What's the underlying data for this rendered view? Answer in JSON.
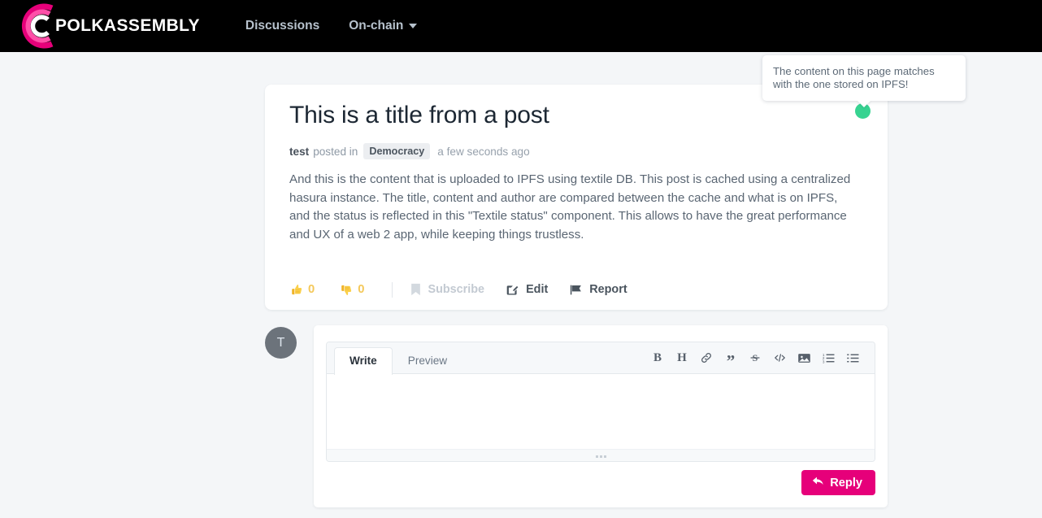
{
  "navbar": {
    "brand": "POLKASSEMBLY",
    "logo_icon": "polkassembly-spiral-logo",
    "links": [
      {
        "label": "Discussions",
        "icon": "",
        "has_caret": false
      },
      {
        "label": "On-chain",
        "icon": "chevron-down-icon",
        "has_caret": true
      }
    ]
  },
  "tooltip": {
    "text": "The content on this page matches with the one stored on IPFS!"
  },
  "post": {
    "title": "This is a title from a post",
    "author": "test",
    "posted_in_label": "posted in",
    "category": "Democracy",
    "time": "a few seconds ago",
    "content": "And this is the content that is uploaded to IPFS using textile DB. This post is cached using a centralized hasura instance. The title, content and author are compared between the cache and what is on IPFS, and the status is reflected in this \"Textile status\" component. This allows to have the great performance and UX of a web 2 app, while keeping things trustless.",
    "status_dot_color": "#37d391",
    "actions": {
      "like_count": "0",
      "dislike_count": "0",
      "like_icon": "thumbs-up-icon",
      "dislike_icon": "thumbs-down-icon",
      "subscribe_label": "Subscribe",
      "subscribe_icon": "bookmark-icon",
      "edit_label": "Edit",
      "edit_icon": "pencil-square-icon",
      "report_label": "Report",
      "report_icon": "flag-icon"
    }
  },
  "comment": {
    "avatar_initial": "T",
    "tabs": [
      {
        "label": "Write",
        "active": true
      },
      {
        "label": "Preview",
        "active": false
      }
    ],
    "toolbar": [
      {
        "name": "bold-icon",
        "glyph": "B"
      },
      {
        "name": "heading-icon",
        "glyph": "H"
      },
      {
        "name": "link-icon",
        "glyph": ""
      },
      {
        "name": "quote-icon",
        "glyph": "”"
      },
      {
        "name": "strikethrough-icon",
        "glyph": ""
      },
      {
        "name": "code-icon",
        "glyph": ""
      },
      {
        "name": "image-icon",
        "glyph": ""
      },
      {
        "name": "ordered-list-icon",
        "glyph": ""
      },
      {
        "name": "unordered-list-icon",
        "glyph": ""
      }
    ],
    "textarea_value": "",
    "textarea_placeholder": "",
    "reply_label": "Reply",
    "reply_icon": "reply-arrow-icon",
    "reply_button_color": "#e6007a",
    "resize_handle_icon": "resize-grip-icon"
  }
}
